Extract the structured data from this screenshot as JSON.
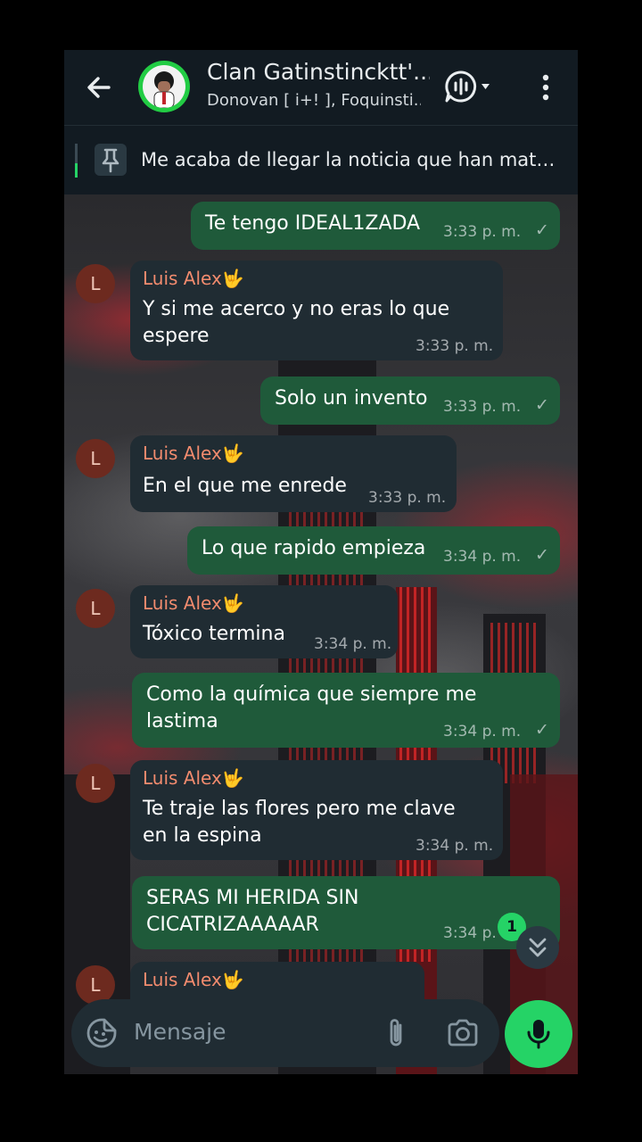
{
  "header": {
    "title": "Clan Gatinstincktt'...",
    "subtitle": "Donovan [ i+! ], Foquinsti...",
    "back_icon": "arrow-left-icon",
    "call_icon": "voice-chat-icon",
    "more_icon": "more-vertical-icon"
  },
  "pinned": {
    "icon": "pin-icon",
    "text": "Me acaba de llegar la noticia que han matad..."
  },
  "messages": [
    {
      "dir": "out",
      "text": "Te tengo IDEAL1ZADA",
      "time": "3:33 p. m.",
      "status": "✓"
    },
    {
      "dir": "in",
      "sender": "Luis Alex🤟",
      "avatar": "L",
      "text": "Y si me acerco y no eras lo que espere",
      "time": "3:33 p. m."
    },
    {
      "dir": "out",
      "text": "Solo un invento",
      "time": "3:33 p. m.",
      "status": "✓"
    },
    {
      "dir": "in",
      "sender": "Luis Alex🤟",
      "avatar": "L",
      "text": "En el que me enrede",
      "time": "3:33 p. m."
    },
    {
      "dir": "out",
      "text": "Lo que rapido empieza",
      "time": "3:34 p. m.",
      "status": "✓"
    },
    {
      "dir": "in",
      "sender": "Luis Alex🤟",
      "avatar": "L",
      "text": "Tóxico termina",
      "time": "3:34 p. m."
    },
    {
      "dir": "out",
      "text": "Como la química que siempre me lastima",
      "time": "3:34 p. m.",
      "status": "✓"
    },
    {
      "dir": "in",
      "sender": "Luis Alex🤟",
      "avatar": "L",
      "text": "Te traje las flores pero me clave en la espina",
      "time": "3:34 p. m."
    },
    {
      "dir": "out",
      "text": "SERAS MI HERIDA SIN CICATRIZAAAAAR",
      "time": "3:34 p. m",
      "status": ""
    },
    {
      "dir": "in",
      "sender": "Luis Alex🤟",
      "avatar": "L",
      "text": "",
      "time": ""
    }
  ],
  "scroll": {
    "unread_count": "1",
    "icon": "double-chevron-down-icon"
  },
  "composer": {
    "placeholder": "Mensaje",
    "sticker_icon": "sticker-icon",
    "attach_icon": "paperclip-icon",
    "camera_icon": "camera-icon",
    "mic_icon": "microphone-icon"
  },
  "colors": {
    "accent": "#25d366",
    "outgoing_bubble": "#1f5a3a",
    "incoming_bubble": "#202c33",
    "sender_name": "#f28b6e"
  }
}
